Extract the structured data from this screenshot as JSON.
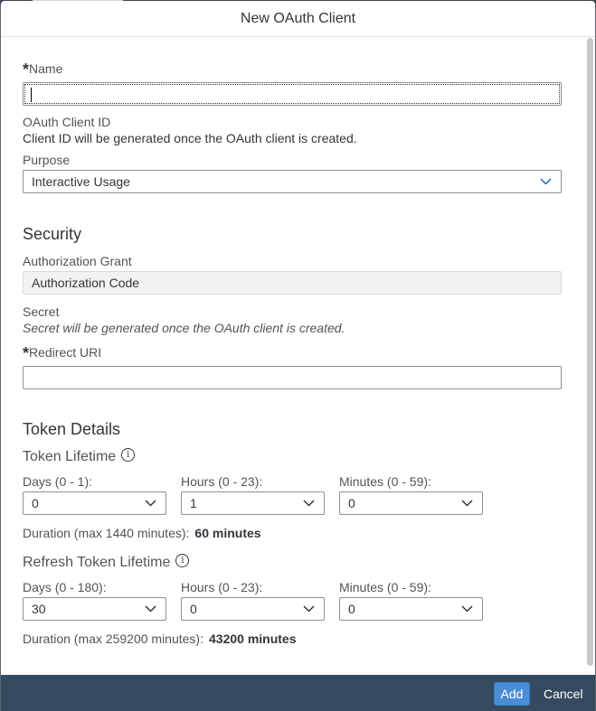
{
  "dialog": {
    "title": "New OAuth Client"
  },
  "form": {
    "name_label": "Name",
    "name_value": "",
    "client_id_label": "OAuth Client ID",
    "client_id_text": "Client ID will be generated once the OAuth client is created.",
    "purpose_label": "Purpose",
    "purpose_value": "Interactive Usage",
    "security_title": "Security",
    "grant_label": "Authorization Grant",
    "grant_value": "Authorization Code",
    "secret_label": "Secret",
    "secret_text": "Secret will be generated once the OAuth client is created.",
    "redirect_label": "Redirect URI",
    "redirect_value": ""
  },
  "token": {
    "section_title": "Token Details",
    "lifetime_title": "Token Lifetime",
    "days_label": "Days (0 - 1):",
    "days_value": "0",
    "hours_label": "Hours (0 - 23):",
    "hours_value": "1",
    "minutes_label": "Minutes (0 - 59):",
    "minutes_value": "0",
    "duration_label": "Duration (max 1440 minutes):",
    "duration_value": "60 minutes"
  },
  "refresh": {
    "lifetime_title": "Refresh Token Lifetime",
    "days_label": "Days (0 - 180):",
    "days_value": "30",
    "hours_label": "Hours (0 - 23):",
    "hours_value": "0",
    "minutes_label": "Minutes (0 - 59):",
    "minutes_value": "0",
    "duration_label": "Duration (max 259200 minutes):",
    "duration_value": "43200 minutes"
  },
  "footer": {
    "add_label": "Add",
    "cancel_label": "Cancel"
  },
  "icons": {
    "info": "info-icon",
    "dropdown": "chevron-down-icon"
  },
  "colors": {
    "footer_bg": "#354a5f",
    "primary_button": "#4a8cd6",
    "chevron": "#0a6ed1"
  }
}
